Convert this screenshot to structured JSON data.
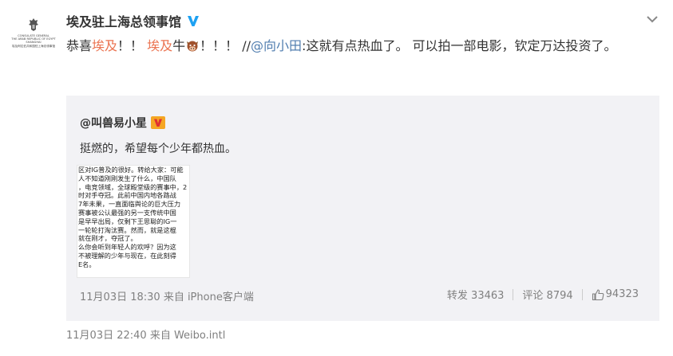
{
  "post": {
    "author": "埃及驻上海总领事馆",
    "content": {
      "p1": "恭喜",
      "hl1": "埃及",
      "p2": "！！ ",
      "hl2": "埃及",
      "p3": "牛",
      "p4": "！！！ //",
      "mention": "@向小田",
      "p5": ":这就有点热血了。 可以拍一部电影，钦定万达投资了。"
    },
    "footer": "11月03日 22:40 来自 Weibo.intl",
    "avatar_text": [
      "CONSULATE GENERAL",
      "THE ARAB REPUBLIC OF EGYPT",
      "SHANGHAI",
      "埃及阿拉伯共和国驻上海总领事馆"
    ]
  },
  "repost": {
    "user": "@叫兽易小星",
    "text": "挺燃的，希望每个少年都热血。",
    "image_lines": [
      "区对IG普及的很好。转给大家：可能",
      "人不知道刚刚发生了什么，中国队",
      "，电竞领域，全球殿堂级的赛事中，2",
      "时对手夺冠。此前中国内地各路战",
      "7年未果，一直面临舆论的巨大压力",
      "赛事被公认最强的另一支传统中国",
      "是早早出局，仅剩下王思聪的IG一",
      "一轮轮打淘汰赛。然而，就是这棍",
      "就在刚才，夺冠了。",
      "么你会听到年轻人的欢呼？因为这",
      "不被理解的少年与现在，在此刻得",
      "E名。"
    ],
    "time": "11月03日 18:30 来自 iPhone客户端",
    "forward": "转发 33463",
    "comment": "评论 8794",
    "likes": "94323"
  },
  "colors": {
    "highlight": "#eb7350",
    "link": "#507daf",
    "verified": "#1da1f2",
    "repost_bg": "#f2f2f5"
  },
  "icons": [
    "eagle-emblem-icon",
    "verified-v-icon",
    "chevron-down-icon",
    "cow-emoji-icon",
    "yellow-v-badge-icon",
    "thumbs-up-icon"
  ]
}
